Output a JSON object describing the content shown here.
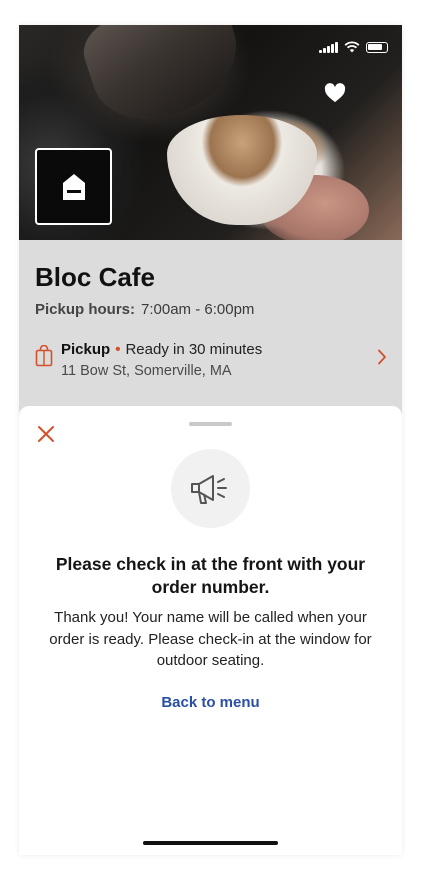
{
  "store": {
    "name": "Bloc Cafe",
    "hours_label": "Pickup hours:",
    "hours_value": "7:00am - 6:00pm"
  },
  "pickup": {
    "mode": "Pickup",
    "ready": "Ready in 30 minutes",
    "address": "11 Bow St, Somerville, MA"
  },
  "sheet": {
    "headline": "Please check in at the front with your order number.",
    "body": "Thank you! Your name will be called when your order is ready. Please check-in at the window for outdoor seating.",
    "back_label": "Back to menu"
  },
  "icons": {
    "favorite": "heart-icon",
    "logo": "store-logo-icon",
    "bag": "bag-icon",
    "chevron": "chevron-right-icon",
    "close": "close-icon",
    "announce": "megaphone-icon"
  },
  "colors": {
    "accent": "#d4502b",
    "link": "#2a4fa3",
    "dim_overlay": "#dcdcdc",
    "icon_gray": "#555555"
  }
}
